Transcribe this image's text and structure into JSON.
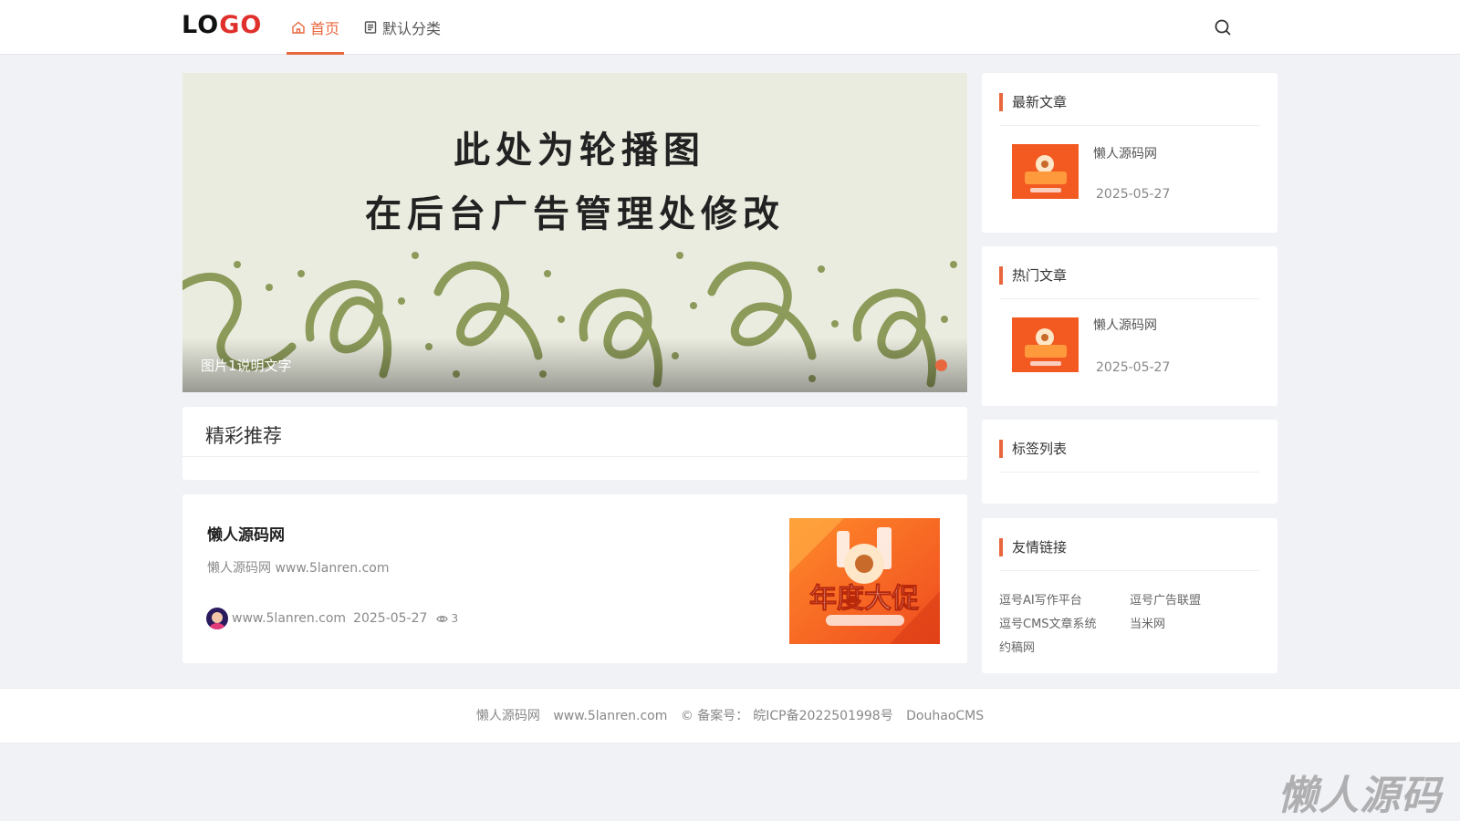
{
  "header": {
    "logo_a": "LO",
    "logo_b": "GO",
    "nav": [
      {
        "label": "首页",
        "icon": "home-icon",
        "active": true
      },
      {
        "label": "默认分类",
        "icon": "list-icon",
        "active": false
      }
    ]
  },
  "banner": {
    "line1": "此处为轮播图",
    "line2": "在后台广告管理处修改",
    "caption": "图片1说明文字"
  },
  "recommend": {
    "title": "精彩推荐"
  },
  "post": {
    "title": "懒人源码网",
    "desc": "懒人源码网 www.5lanren.com",
    "author": "www.5lanren.com",
    "date": "2025-05-27",
    "views": "3",
    "thumb_text": "年度大促"
  },
  "sidebar": {
    "latest": {
      "title": "最新文章",
      "item_title": "懒人源码网",
      "item_date": "2025-05-27"
    },
    "hot": {
      "title": "热门文章",
      "item_title": "懒人源码网",
      "item_date": "2025-05-27"
    },
    "tags": {
      "title": "标签列表"
    },
    "links": {
      "title": "友情链接",
      "items": [
        "逗号AI写作平台",
        "逗号广告联盟",
        "逗号CMS文章系统",
        "当米网",
        "约稿网"
      ]
    }
  },
  "footer": {
    "site": "懒人源码网",
    "domain": "www.5lanren.com",
    "icp_label": "© 备案号：",
    "icp": "皖ICP备2022501998号",
    "powered": "DouhaoCMS"
  },
  "watermark": "懒人源码",
  "colors": {
    "accent": "#e9673e",
    "background": "#f1f2f6"
  }
}
